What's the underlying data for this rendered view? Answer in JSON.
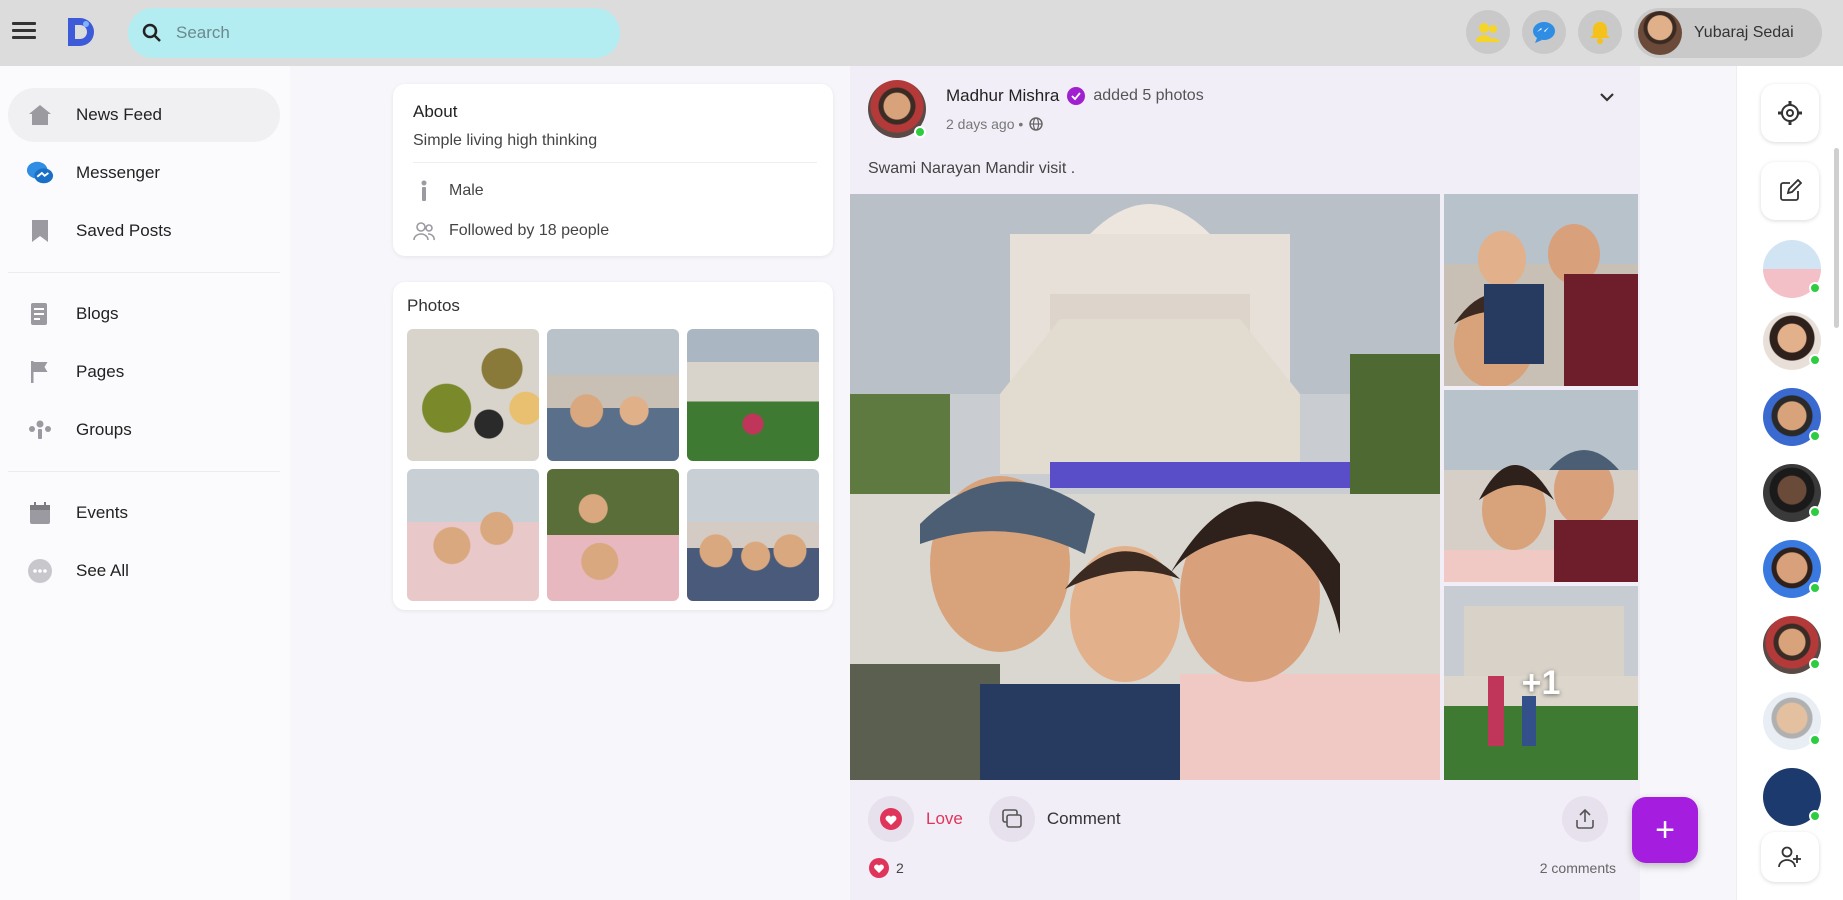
{
  "search": {
    "placeholder": "Search"
  },
  "user": {
    "name": "Yubaraj Sedai"
  },
  "nav": [
    {
      "label": "News Feed",
      "icon": "home-icon"
    },
    {
      "label": "Messenger",
      "icon": "messenger-icon"
    },
    {
      "label": "Saved Posts",
      "icon": "bookmark-icon"
    },
    {
      "label": "Blogs",
      "icon": "blog-icon"
    },
    {
      "label": "Pages",
      "icon": "flag-icon"
    },
    {
      "label": "Groups",
      "icon": "groups-icon"
    },
    {
      "label": "Events",
      "icon": "calendar-icon"
    },
    {
      "label": "See All",
      "icon": "more-icon"
    }
  ],
  "about": {
    "title": "About",
    "bio": "Simple living high thinking",
    "gender": "Male",
    "followers": "Followed by 18 people"
  },
  "photos": {
    "title": "Photos"
  },
  "post": {
    "author": "Madhur Mishra",
    "action": "added 5 photos",
    "time": "2 days ago •",
    "caption": "Swami Narayan Mandir visit .",
    "more_photos": "+1",
    "love_label": "Love",
    "comment_label": "Comment",
    "reaction_count": "2",
    "comments_count": "2 comments"
  },
  "fab": {
    "label": "+"
  },
  "colors": {
    "accent": "#a51ee0",
    "search_bg": "#b3ecf1",
    "love": "#e0355b",
    "online": "#2ecc40"
  }
}
